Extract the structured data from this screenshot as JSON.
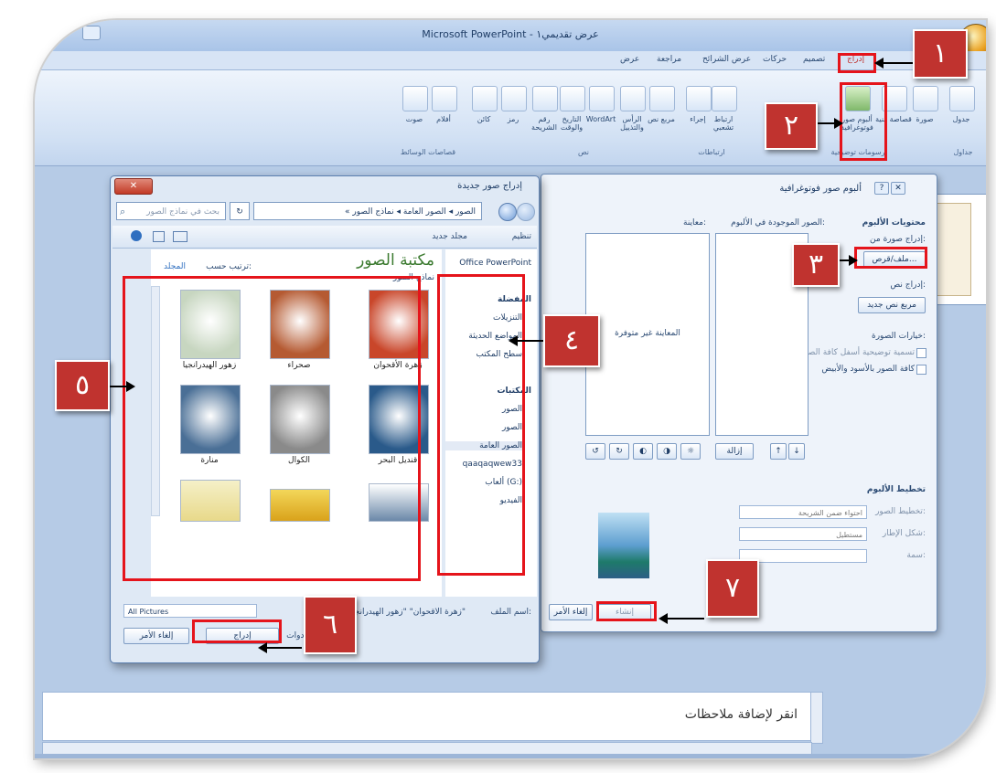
{
  "window": {
    "title": "Microsoft PowerPoint - عرض تقديمي١"
  },
  "ribbon_tabs": [
    "إدراج",
    "تصميم",
    "حركات",
    "عرض الشرائح",
    "مراجعة",
    "عرض"
  ],
  "ribbon_buttons": {
    "table": "جدول",
    "picture": "صورة",
    "clipart": "قصاصة فنية",
    "photo_album": "ألبوم صور فوتوغرافية",
    "link": "ارتباط تشعبي",
    "action": "إجراء",
    "textbox": "مربع نص",
    "header_footer": "الرأس والتذييل",
    "wordart": "WordArt",
    "date_time": "التاريخ والوقت",
    "slide_number": "رقم الشريحة",
    "symbol": "رمز",
    "object": "كائن",
    "movie": "أفلام",
    "sound": "صوت"
  },
  "ribbon_groups": [
    "جداول",
    "رسومات توضيحية",
    "ارتباطات",
    "نص",
    "قصاصات الوسائط"
  ],
  "notes": {
    "placeholder": "انقر لإضافة ملاحظات"
  },
  "album_dialog": {
    "title": "ألبوم صور فوتوغرافية",
    "album_content": "محتويات الألبوم",
    "insert_picture_from": "إدراج صورة من:",
    "file_disk_button": "ملف/قرص...",
    "insert_text": "إدراج نص:",
    "new_textbox_button": "مربع نص جديد",
    "picture_options": "خيارات الصورة:",
    "option_captions": "تسمية توضيحية أسفل كافة الصور",
    "option_bw": "كافة الصور بالأسود والأبيض",
    "pictures_in_album": "الصور الموجودة في الألبوم:",
    "preview": "معاينة:",
    "no_preview": "المعاينة غير متوفرة",
    "remove_button": "إزالة",
    "album_layout": "تخطيط الألبوم",
    "picture_layout_label": "تخطيط الصور:",
    "picture_layout_value": "احتواء ضمن الشريحة",
    "frame_shape_label": "شكل الإطار:",
    "frame_shape_value": "مستطيل",
    "theme_label": "سمة:",
    "create_button": "إنشاء",
    "cancel_button": "إلغاء الأمر"
  },
  "insert_dialog": {
    "title": "إدراج صور جديدة",
    "breadcrumb": "« الصور ◂ الصور العامة ◂ نماذج الصور",
    "search_placeholder": "بحث في نماذج الصور",
    "organize": "تنظيم",
    "new_folder": "مجلد جديد",
    "library_title": "مكتبة الصور",
    "library_subtitle": "نماذج الصور",
    "arrange_by": "ترتيب حسب:",
    "arrange_value": "المجلد",
    "nav_items": [
      "Office PowerPoint",
      "المفضلة",
      "التنزيلات",
      "المواضع الحديثة",
      "سطح المكتب",
      "المكتبات",
      "الصور",
      "الصور",
      "الصور العامة",
      "qaaqaqwew33",
      "ألعاب (G:)",
      "الفيديو"
    ],
    "thumbnails": [
      {
        "caption": "زهرة الأقحوان",
        "color": "#c9462a"
      },
      {
        "caption": "صحراء",
        "color": "#b55a32"
      },
      {
        "caption": "زهور الهيدرانجيا",
        "color": "#c7d6c0"
      },
      {
        "caption": "قنديل البحر",
        "color": "#2a5a8a"
      },
      {
        "caption": "الكوال",
        "color": "#8a8a8a"
      },
      {
        "caption": "منارة",
        "color": "#4a6f96"
      }
    ],
    "filename_label": "اسم الملف:",
    "filename_value": "\"زهرة الأقحوان\" \"زهور الهيدرانجيا\"",
    "filetype_value": "All Pictures",
    "tools": "أدوات",
    "insert_button": "إدراج",
    "cancel_button": "إلغاء الأمر"
  },
  "callouts": [
    "١",
    "٢",
    "٣",
    "٤",
    "٥",
    "٦",
    "٧"
  ],
  "colors": {
    "callout_bg": "#c0332f",
    "highlight": "#e5141b"
  }
}
